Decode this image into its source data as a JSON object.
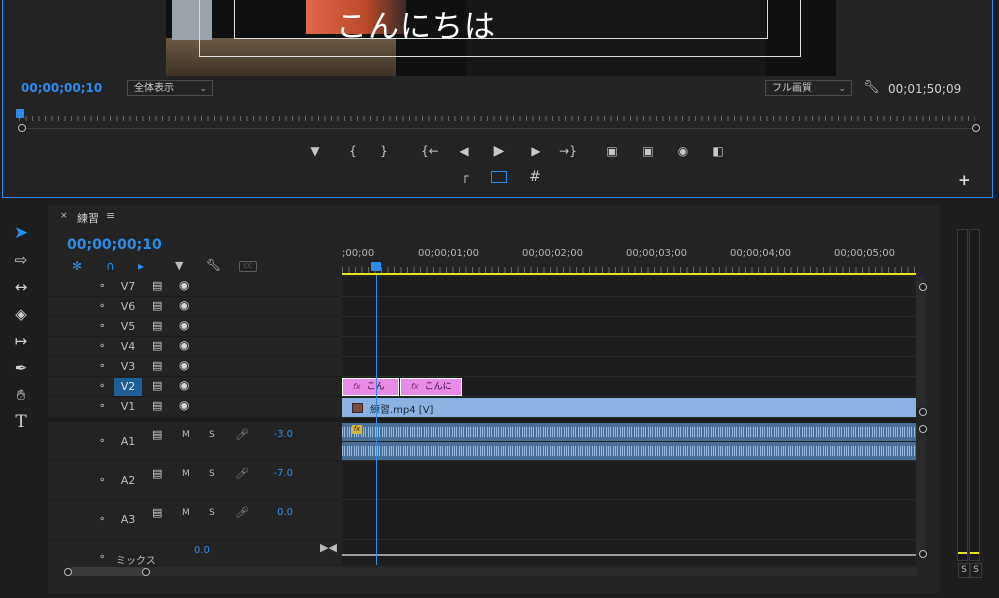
{
  "program_monitor": {
    "caption": "こんにちは",
    "timecode_current": "00;00;00;10",
    "zoom_select": "全体表示",
    "quality_select": "フル画質",
    "timecode_duration": "00;01;50;09"
  },
  "timeline": {
    "sequence_name": "練習",
    "timecode": "00;00;00;10",
    "ruler_labels": [
      ";00;00",
      "00;00;01;00",
      "00;00;02;00",
      "00;00;03;00",
      "00;00;04;00",
      "00;00;05;00"
    ],
    "video_tracks": [
      "V7",
      "V6",
      "V5",
      "V4",
      "V3",
      "V2",
      "V1"
    ],
    "active_track": "V2",
    "audio_tracks": [
      {
        "name": "A1",
        "mute": "M",
        "solo": "S",
        "volume": "-3.0"
      },
      {
        "name": "A2",
        "mute": "M",
        "solo": "S",
        "volume": "-7.0"
      },
      {
        "name": "A3",
        "mute": "M",
        "solo": "S",
        "volume": "0.0"
      }
    ],
    "mix_label": "ミックス",
    "mix_volume": "0.0",
    "clips": {
      "v2_clip1": "こん",
      "v2_clip2": "こんに",
      "v1_clip": "練習.mp4 [V]",
      "fx_badge": "fx"
    }
  },
  "meter": {
    "solo_left": "S",
    "solo_right": "S"
  },
  "colors": {
    "accent_blue": "#2d8ceb",
    "graphic_clip": "#e88ae6",
    "video_clip": "#8ab3e3",
    "audio_clip": "#4a6f96",
    "work_area": "#e8e018"
  }
}
